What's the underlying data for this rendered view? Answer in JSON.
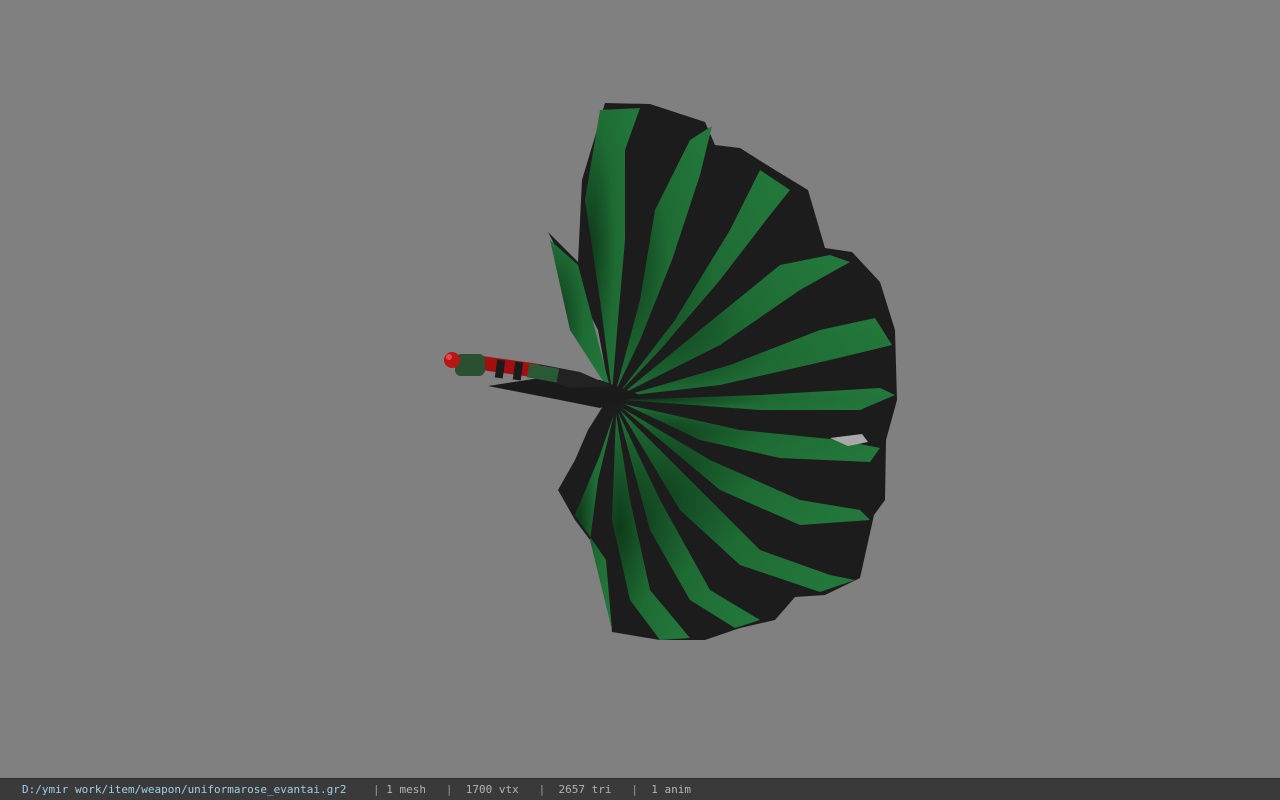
{
  "viewport": {
    "background_color": "#808080",
    "model_colors": {
      "green": "#1e6b34",
      "dark_green": "#154f26",
      "black": "#1c1c1c",
      "red": "#a01010"
    }
  },
  "status_bar": {
    "file_path": "D:/ymir work/item/weapon/uniformarose_evantai.gr2",
    "separator": "|",
    "mesh": "1 mesh",
    "vertices": "1700 vtx",
    "triangles": "2657 tri",
    "animations": "1 anim",
    "background_color": "#3a3a3a"
  }
}
